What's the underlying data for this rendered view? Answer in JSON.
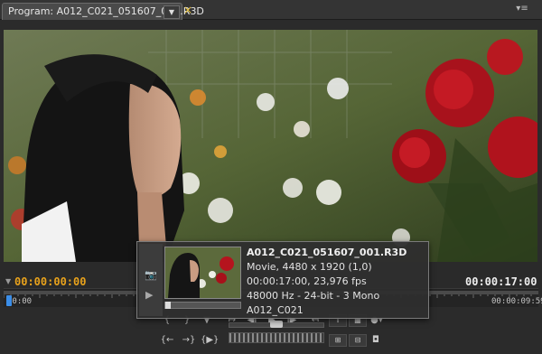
{
  "panel": {
    "tab_label": "Program: A012_C021_051607_001.R3D",
    "close_symbol": "×",
    "menu_symbol": "≡"
  },
  "timecode": {
    "current": "00:00:00:00",
    "duration": "00:00:17:00"
  },
  "ruler": {
    "start_label": "00:00",
    "end_label": "00:00:09:59"
  },
  "tooltip": {
    "clip_name": "A012_C021_051607_001.R3D",
    "lines": [
      "Movie, 4480 x 1920 (1,0)",
      "00:00:17:00, 23,976 fps",
      "48000 Hz - 24-bit - 3 Mono",
      "A012_C021"
    ],
    "scrub_position": 0.0
  },
  "controls": {
    "shuttle_position": 0.5
  },
  "colors": {
    "timecode_current": "#e8a21c",
    "playhead": "#3b8ee8",
    "tab_close": "#e8c23a"
  },
  "icons": [
    "dropdown-arrow-icon",
    "close-icon",
    "panel-menu-icon",
    "camera-icon",
    "play-icon",
    "mark-in-icon",
    "mark-out-icon",
    "step-back-icon",
    "play-stop-icon",
    "step-forward-icon",
    "lift-icon",
    "extract-icon",
    "export-frame-icon",
    "safe-margins-icon",
    "output-icon",
    "trim-icon",
    "go-to-in-icon",
    "go-to-out-icon",
    "play-in-to-out-icon",
    "loop-icon"
  ]
}
